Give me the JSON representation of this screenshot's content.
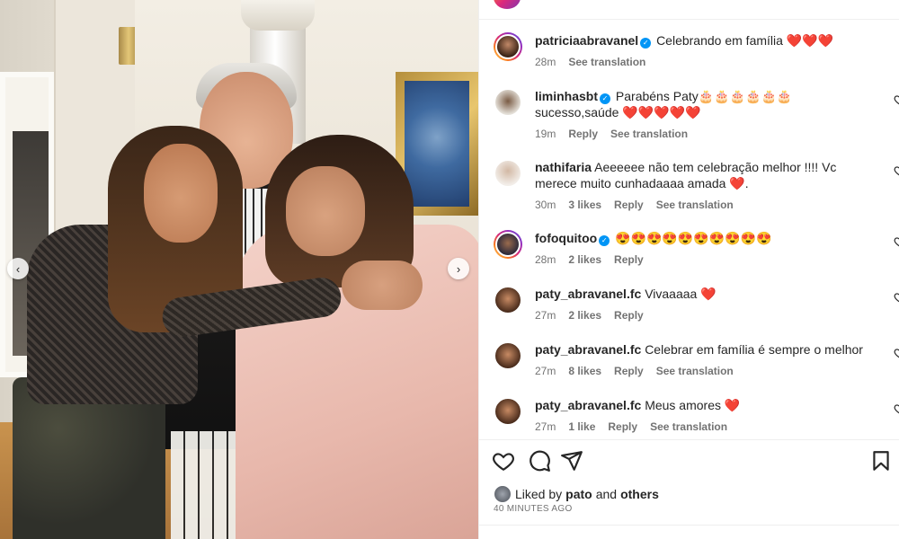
{
  "post": {
    "caption": {
      "username": "patriciaabravanel",
      "verified": true,
      "text": "Celebrando em família ❤️❤️❤️",
      "time": "28m",
      "translate": "See translation"
    }
  },
  "comments": [
    {
      "username": "liminhasbt",
      "verified": true,
      "text": "Parabéns Paty🎂🎂🎂🎂🎂🎂sucesso,saúde ❤️❤️❤️❤️❤️",
      "time": "19m",
      "likes": "",
      "reply": "Reply",
      "translate": "See translation"
    },
    {
      "username": "nathifaria",
      "verified": false,
      "text": "Aeeeeee não tem celebração melhor !!!! Vc merece muito cunhadaaaa amada ❤️.",
      "time": "30m",
      "likes": "3 likes",
      "reply": "Reply",
      "translate": "See translation"
    },
    {
      "username": "fofoquitoo",
      "verified": true,
      "text": "😍😍😍😍😍😍😍😍😍😍",
      "time": "28m",
      "likes": "2 likes",
      "reply": "Reply",
      "translate": ""
    },
    {
      "username": "paty_abravanel.fc",
      "verified": false,
      "text": "Vivaaaaa ❤️",
      "time": "27m",
      "likes": "2 likes",
      "reply": "Reply",
      "translate": ""
    },
    {
      "username": "paty_abravanel.fc",
      "verified": false,
      "text": "Celebrar em família é sempre o melhor",
      "time": "27m",
      "likes": "8 likes",
      "reply": "Reply",
      "translate": "See translation"
    },
    {
      "username": "paty_abravanel.fc",
      "verified": false,
      "text": "Meus amores ❤️",
      "time": "27m",
      "likes": "1 like",
      "reply": "Reply",
      "translate": "See translation"
    }
  ],
  "liked_by": {
    "prefix": "Liked by",
    "user": "pato",
    "and": "and",
    "others": "others"
  },
  "post_time": "40 MINUTES AGO",
  "icons": {
    "like": "heart-outline-icon",
    "comment": "comment-bubble-icon",
    "share": "paper-plane-icon",
    "save": "bookmark-icon",
    "carousel_prev": "chevron-left-icon",
    "carousel_next": "chevron-right-icon"
  },
  "colors": {
    "accent": "#0095f6",
    "text": "#262626",
    "muted": "#737373",
    "heart": "#ed4956"
  }
}
